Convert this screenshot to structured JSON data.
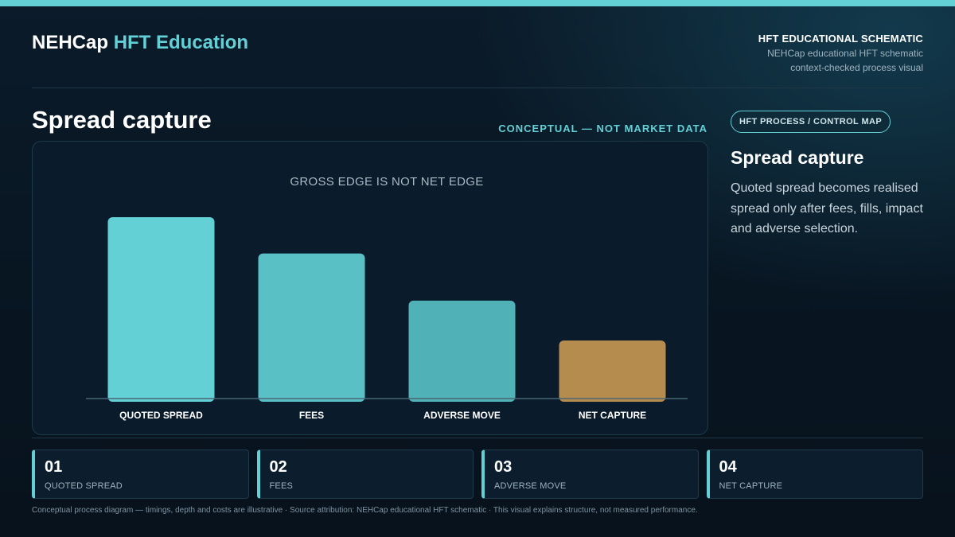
{
  "header": {
    "brand_main": "NEHCap",
    "brand_accent": "HFT Education",
    "right_title": "HFT EDUCATIONAL SCHEMATIC",
    "right_line1": "NEHCap educational HFT schematic",
    "right_line2": "context-checked process visual"
  },
  "main": {
    "title": "Spread capture",
    "tag": "CONCEPTUAL — NOT MARKET DATA"
  },
  "side": {
    "chip": "HFT PROCESS / CONTROL MAP",
    "title": "Spread capture",
    "description": "Quoted spread becomes realised spread only after fees, fills, impact and adverse selection."
  },
  "steps": [
    {
      "num": "01",
      "label": "QUOTED SPREAD"
    },
    {
      "num": "02",
      "label": "FEES"
    },
    {
      "num": "03",
      "label": "ADVERSE MOVE"
    },
    {
      "num": "04",
      "label": "NET CAPTURE"
    }
  ],
  "footnote": "Conceptual process diagram — timings, depth and costs are illustrative · Source attribution: NEHCap educational HFT schematic · This visual explains structure, not measured performance.",
  "colors": {
    "accent": "#63d0d6",
    "bars": [
      "#63d0d6",
      "#59c0c6",
      "#50b1b6",
      "#b68c4e"
    ],
    "baseline": "#4a6676"
  },
  "chart_data": {
    "type": "bar",
    "title": "GROSS EDGE IS NOT NET EDGE",
    "categories": [
      "QUOTED SPREAD",
      "FEES",
      "ADVERSE MOVE",
      "NET CAPTURE"
    ],
    "values": [
      100,
      80,
      54,
      32
    ],
    "ylim": [
      0,
      100
    ],
    "xlabel": "",
    "ylabel": "",
    "grid": false,
    "legend": "none"
  }
}
